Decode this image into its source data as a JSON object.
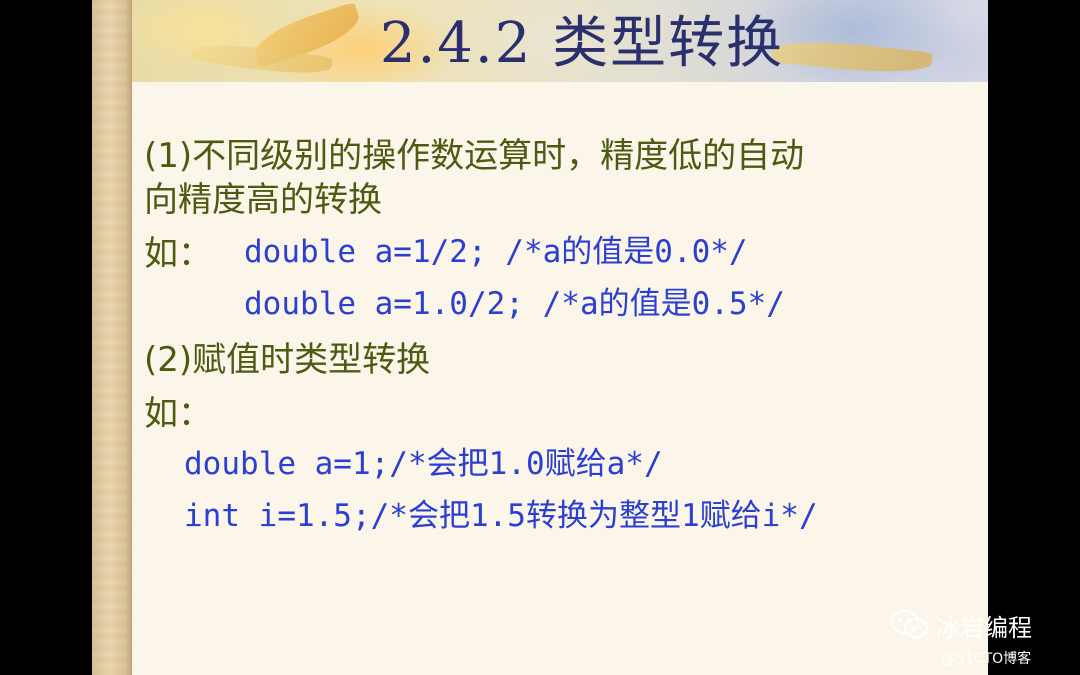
{
  "slide": {
    "title": "2.4.2  类型转换",
    "lines": [
      {
        "id": "rule1_a",
        "text": "(1)不同级别的操作数运算时，精度低的自动"
      },
      {
        "id": "rule1_b",
        "text": "向精度高的转换"
      },
      {
        "id": "ex1_label",
        "text": "如："
      },
      {
        "id": "ex1_code1",
        "text": "double a=1/2; /*a的值是0.0*/"
      },
      {
        "id": "ex1_code2",
        "text": "double a=1.0/2; /*a的值是0.5*/"
      },
      {
        "id": "rule2",
        "text": "(2)赋值时类型转换"
      },
      {
        "id": "ex2_label",
        "text": "如："
      },
      {
        "id": "ex2_code1",
        "text": "double a=1;/*会把1.0赋给a*/"
      },
      {
        "id": "ex2_code2",
        "text": "int  i=1.5;/*会把1.5转换为整型1赋给i*/"
      }
    ]
  },
  "watermark": {
    "name": "冰岩编程",
    "site": "@51CTO博客"
  },
  "colors": {
    "title": "#2a2f6e",
    "body_text": "#4d5a12",
    "code_text": "#2b3fd4",
    "background": "#fbf6e9"
  }
}
